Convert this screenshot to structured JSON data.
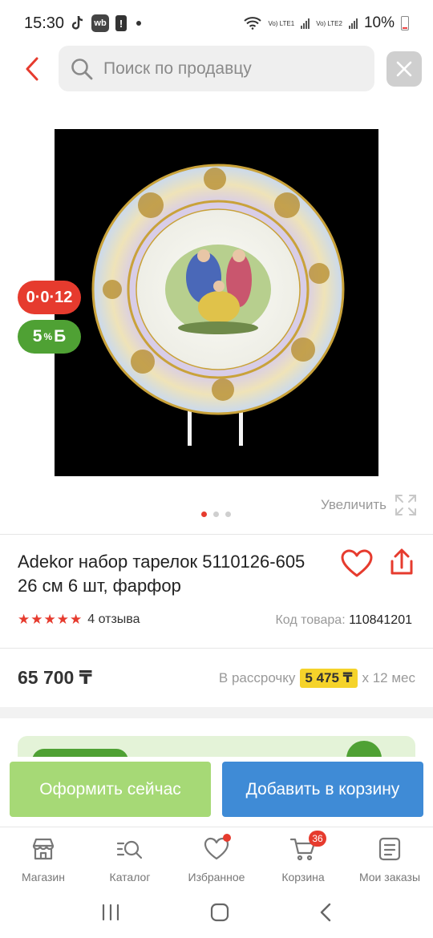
{
  "status_bar": {
    "time": "15:30",
    "wb_badge": "wb",
    "alert_badge": "!",
    "lte1": "Vo) LTE1",
    "lte2": "Vo) LTE2",
    "battery": "10%"
  },
  "search": {
    "placeholder": "Поиск по продавцу"
  },
  "gallery": {
    "timer_badge": "0·0·12",
    "bonus_value": "5",
    "bonus_sup": "%",
    "bonus_currency": "Б",
    "zoom_label": "Увеличить",
    "pages": 3,
    "active_page": 1
  },
  "product": {
    "title": "Adekor набор тарелок 5110126-605 26 см 6 шт, фарфор",
    "rating": 5,
    "reviews": "4 отзыва",
    "sku_label": "Код товара:",
    "sku_value": "110841201",
    "price": "65 700 ₸",
    "installment_label": "В рассрочку",
    "installment_amount": "5 475 ₸",
    "installment_term": "х 12 мес"
  },
  "actions": {
    "buy_now": "Оформить сейчас",
    "add_to_cart": "Добавить в корзину"
  },
  "bottom_nav": {
    "items": [
      {
        "label": "Магазин",
        "icon": "store-icon"
      },
      {
        "label": "Каталог",
        "icon": "catalog-search-icon"
      },
      {
        "label": "Избранное",
        "icon": "heart-icon"
      },
      {
        "label": "Корзина",
        "icon": "cart-icon",
        "count": "36"
      },
      {
        "label": "Мои заказы",
        "icon": "orders-icon"
      }
    ]
  },
  "colors": {
    "accent_red": "#e63b2e",
    "bonus_green": "#4fa134",
    "buy_button": "#a6d976",
    "cart_button": "#3f8bd6",
    "installment_yellow": "#f5d32a"
  }
}
